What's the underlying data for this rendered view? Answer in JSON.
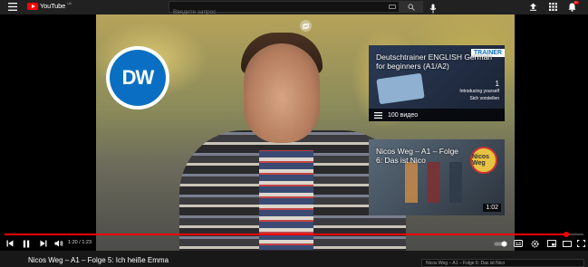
{
  "topbar": {
    "logo_text": "YouTube",
    "logo_country": "UA",
    "search_placeholder": "Введите запрос",
    "notification_count": "9+"
  },
  "player": {
    "channel_logo": "DW",
    "time_current": "1:20",
    "time_sep": " / ",
    "time_total": "1:23",
    "progress": 0.97
  },
  "endcards": [
    {
      "title": "Deutschtrainer ENGLISH German for beginners (A1/A2)",
      "badge": "TRAINER",
      "number": "1",
      "line1": "Introducing yourself",
      "line2": "Sich vorstellen",
      "footer": "100 видео"
    },
    {
      "title": "Nicos Weg – A1 – Folge 6: Das ist Nico",
      "badge": "Nicos Weg",
      "duration": "1:02"
    }
  ],
  "below": {
    "title": "Nicos Weg – A1 – Folge 5: Ich heiße Emma",
    "upnext": "Nicos Weg – A1 – Folge 6: Das ist Nico"
  },
  "colors": {
    "accent": "#ff0000",
    "dw_blue": "#0a6fc2"
  },
  "icons": [
    "menu-icon",
    "youtube-logo-icon",
    "keyboard-icon",
    "search-icon",
    "mic-icon",
    "upload-icon",
    "apps-icon",
    "bell-icon",
    "cards-icon",
    "playlist-icon",
    "skip-back-icon",
    "pause-icon",
    "skip-forward-icon",
    "volume-icon",
    "autoplay-toggle-icon",
    "captions-icon",
    "settings-icon",
    "miniplayer-icon",
    "theater-icon",
    "fullscreen-icon"
  ]
}
